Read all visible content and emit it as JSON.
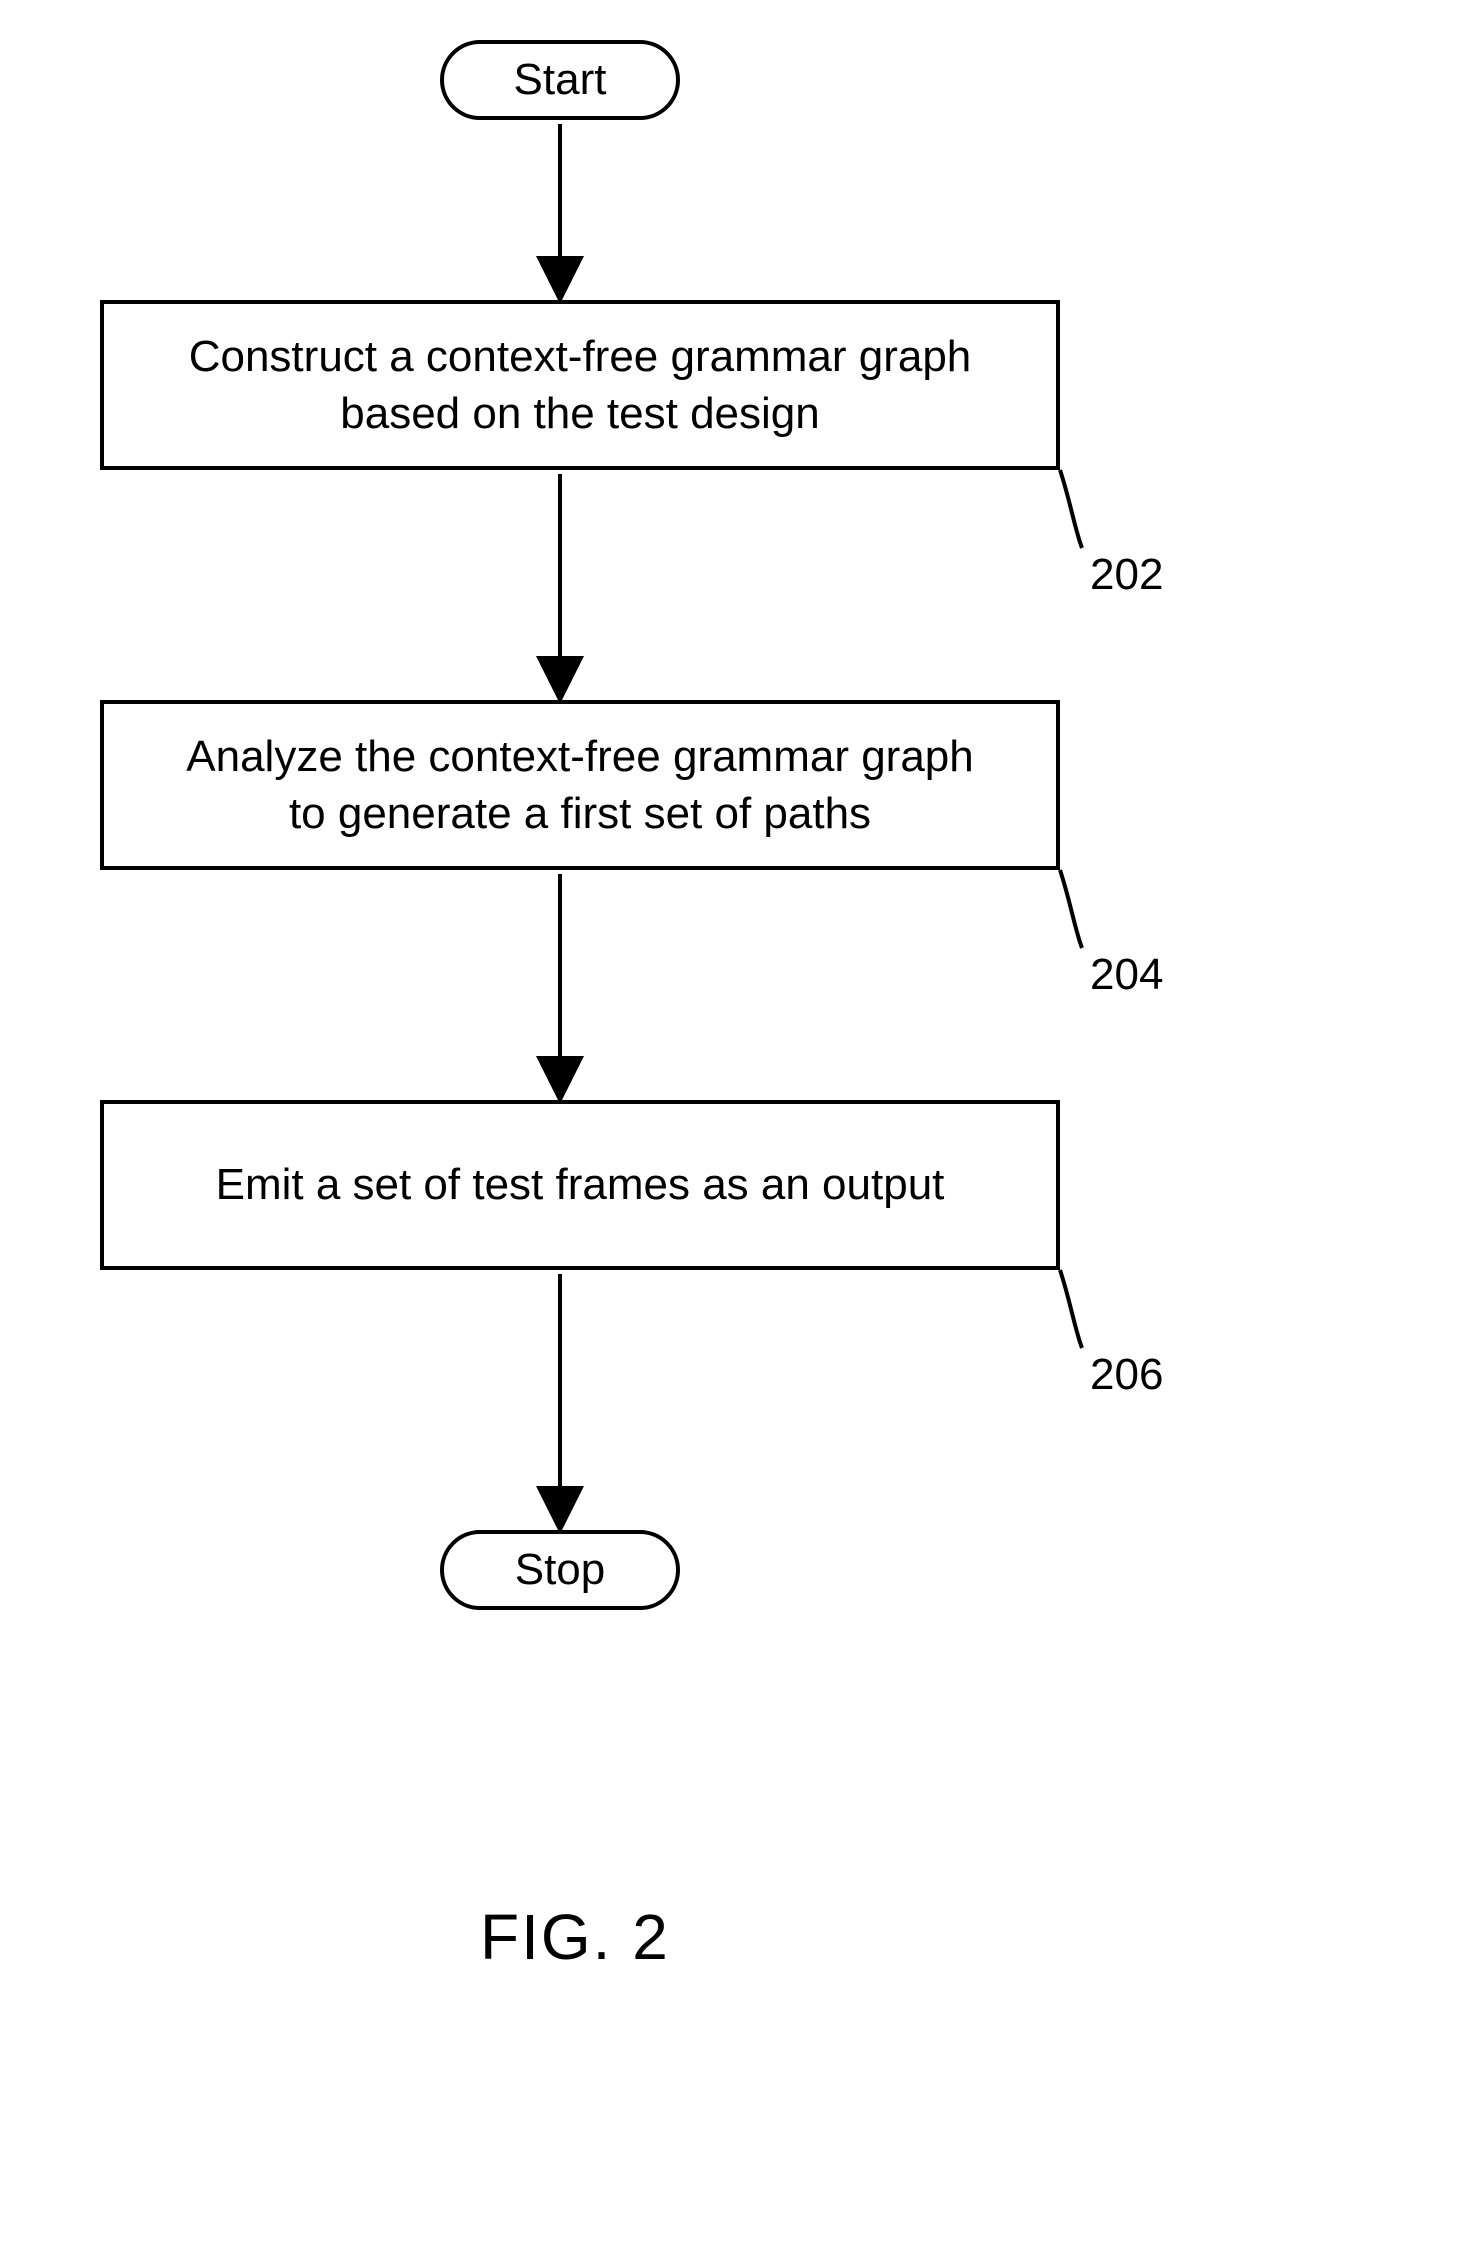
{
  "chart_data": {
    "type": "flowchart",
    "title": "FIG. 2",
    "nodes": [
      {
        "id": "start",
        "shape": "terminator",
        "label": "Start"
      },
      {
        "id": "n202",
        "shape": "process",
        "ref": "202",
        "text": [
          "Construct a context-free grammar graph",
          "based on the test design"
        ]
      },
      {
        "id": "n204",
        "shape": "process",
        "ref": "204",
        "text": [
          "Analyze the context-free grammar graph",
          "to generate a first set of paths"
        ]
      },
      {
        "id": "n206",
        "shape": "process",
        "ref": "206",
        "text": [
          "Emit a set of test frames as an output"
        ]
      },
      {
        "id": "stop",
        "shape": "terminator",
        "label": "Stop"
      }
    ],
    "edges": [
      [
        "start",
        "n202"
      ],
      [
        "n202",
        "n204"
      ],
      [
        "n204",
        "n206"
      ],
      [
        "n206",
        "stop"
      ]
    ]
  },
  "terminators": {
    "start": "Start",
    "stop": "Stop"
  },
  "steps": {
    "s1_l1": "Construct a context-free grammar graph",
    "s1_l2": "based on the test design",
    "s2_l1": "Analyze the context-free grammar graph",
    "s2_l2": "to generate a first set of paths",
    "s3_l1": "Emit a set of test frames as an output"
  },
  "refs": {
    "r1": "202",
    "r2": "204",
    "r3": "206"
  },
  "figure_label": "FIG. 2"
}
